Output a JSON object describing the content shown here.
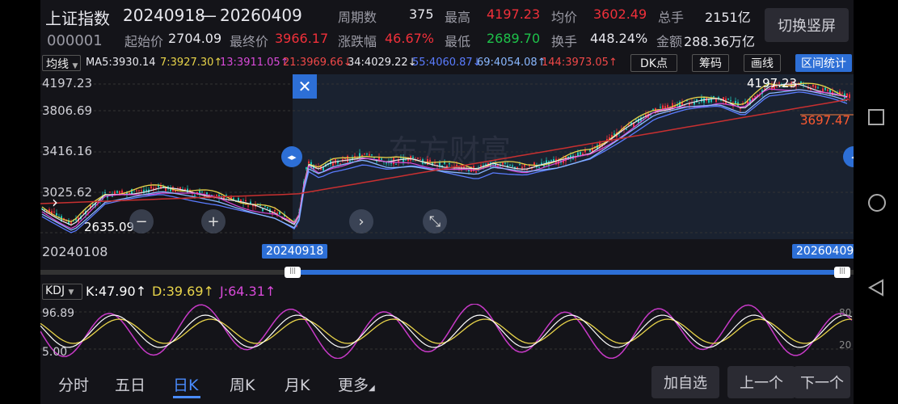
{
  "header": {
    "index_name": "上证指数",
    "range_start": "20240918",
    "range_dash": "—",
    "range_end": "20260409",
    "code": "000001",
    "stats": {
      "periods_label": "周期数",
      "periods_value": "375",
      "high_label": "最高",
      "high_value": "4197.23",
      "avg_label": "均价",
      "avg_value": "3602.49",
      "volume_label": "总手",
      "volume_value": "2151亿",
      "start_label": "起始价",
      "start_value": "2704.09",
      "end_label": "最终价",
      "end_value": "3966.17",
      "change_label": "涨跌幅",
      "change_value": "46.67%",
      "low_label": "最低",
      "low_value": "2689.70",
      "turnover_label": "换手",
      "turnover_value": "448.24%",
      "amount_label": "金额",
      "amount_value": "288.36万亿"
    },
    "switch_button": "切换竖屏"
  },
  "ma_bar": {
    "selector": "均线",
    "items": [
      {
        "text": "MA5:3930.14",
        "color": "#e8e8ee"
      },
      {
        "text": "7:3927.30↑",
        "color": "#e8d44a"
      },
      {
        "text": "13:3911.05↑",
        "color": "#d94ad9"
      },
      {
        "text": "21:3969.66↓",
        "color": "#f04848"
      },
      {
        "text": "34:4029.22↓",
        "color": "#e8e8ee"
      },
      {
        "text": "55:4060.87↓",
        "color": "#5a7cff"
      },
      {
        "text": "69:4054.08↑",
        "color": "#8ab8ff"
      },
      {
        "text": "144:3973.05↑",
        "color": "#f04848"
      }
    ],
    "dk_button": "DK点",
    "chips_button": "筹码",
    "draw_button": "画线",
    "interval_button": "区间统计"
  },
  "chart": {
    "y_labels": [
      "4197.23",
      "3806.69",
      "3416.16",
      "3025.62",
      "2635.09"
    ],
    "max_label": "4197.23",
    "right_label": "3697.47",
    "start_date": "20240108",
    "range_start": "20240918",
    "range_end": "20260409",
    "watermark": "东方财富"
  },
  "kdj": {
    "selector": "KDJ",
    "k": "K:47.90↑",
    "d": "D:39.69↑",
    "j": "J:64.31↑",
    "y_top": "96.89",
    "y_bottom": "5.00",
    "right_top": "80",
    "right_bottom": "20"
  },
  "tabs": [
    "分时",
    "五日",
    "日K",
    "周K",
    "月K",
    "更多"
  ],
  "active_tab": "日K",
  "buttons": {
    "add_watch": "加自选",
    "prev": "上一个",
    "next": "下一个"
  }
}
